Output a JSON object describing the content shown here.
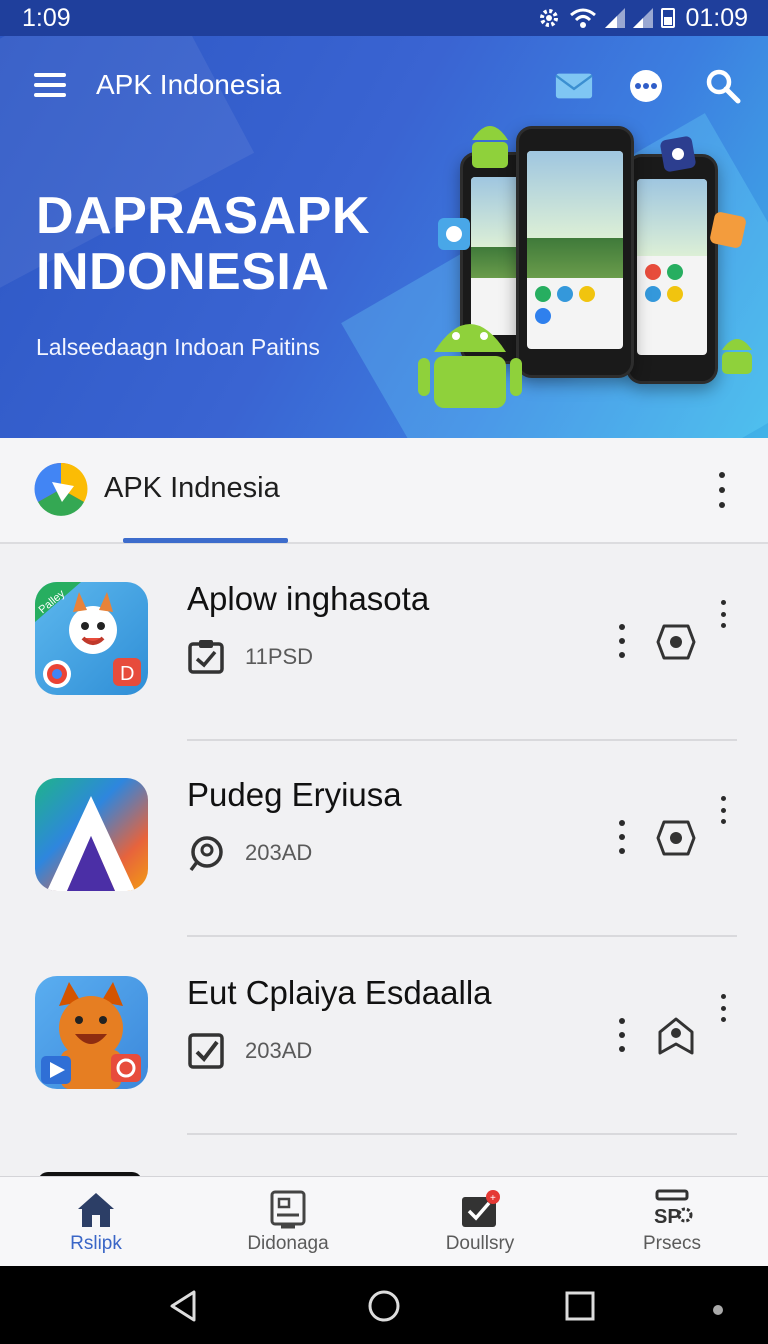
{
  "status_bar": {
    "time_left": "1:09",
    "time_right": "01:09"
  },
  "header": {
    "app_title": "APK Indonesia",
    "icons": [
      "menu-icon",
      "mail-icon",
      "more-horizontal-icon",
      "search-icon"
    ]
  },
  "banner": {
    "headline": "DAPRASAPK INDONESIA",
    "subtitle": "Lalseedaagn  Indoan Paitins"
  },
  "section": {
    "title": "APK  Indnesia",
    "accent_color": "#3d6ccc"
  },
  "apps": [
    {
      "name": "Aplow inghasota",
      "meta": "11PSD",
      "meta_icon": "clipboard-check-icon",
      "action_icon": "camera-icon",
      "icon_badge": "Palley"
    },
    {
      "name": "Pudeg Eryiusa",
      "meta": "203AD",
      "meta_icon": "chat-bubble-icon",
      "action_icon": "camera-icon"
    },
    {
      "name": "Eut  Cplaiya Esdaalla",
      "meta": "203AD",
      "meta_icon": "checkbox-icon",
      "action_icon": "home-shield-icon"
    }
  ],
  "bottom_nav": {
    "items": [
      {
        "label": "Rslipk",
        "icon": "home-icon",
        "active": true
      },
      {
        "label": "Didonaga",
        "icon": "image-frame-icon",
        "active": false
      },
      {
        "label": "Doullsry",
        "icon": "calendar-check-icon",
        "active": false
      },
      {
        "label": "Prsecs",
        "icon": "settings-sp-icon",
        "active": false,
        "icon_text": "SP"
      }
    ]
  },
  "colors": {
    "status_bar": "#1f3f9c",
    "banner_start": "#2d57c4",
    "banner_end": "#41b3e8",
    "active_nav": "#3a66c7"
  }
}
